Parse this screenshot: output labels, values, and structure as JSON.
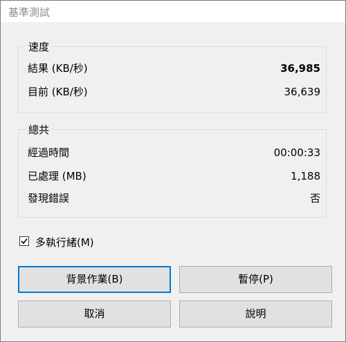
{
  "window": {
    "title": "基準測試"
  },
  "speed": {
    "label": "速度",
    "rows": [
      {
        "label": "結果 (KB/秒)",
        "value": "36,985"
      },
      {
        "label": "目前 (KB/秒)",
        "value": "36,639"
      }
    ]
  },
  "total": {
    "label": "總共",
    "rows": [
      {
        "label": "經過時間",
        "value": "00:00:33"
      },
      {
        "label": "已處理 (MB)",
        "value": "1,188"
      },
      {
        "label": "發現錯誤",
        "value": "否"
      }
    ]
  },
  "multithread": {
    "label": "多執行緒(M)",
    "checked": true
  },
  "buttons": {
    "background": "背景作業(B)",
    "pause": "暫停(P)",
    "cancel": "取消",
    "help": "說明"
  }
}
